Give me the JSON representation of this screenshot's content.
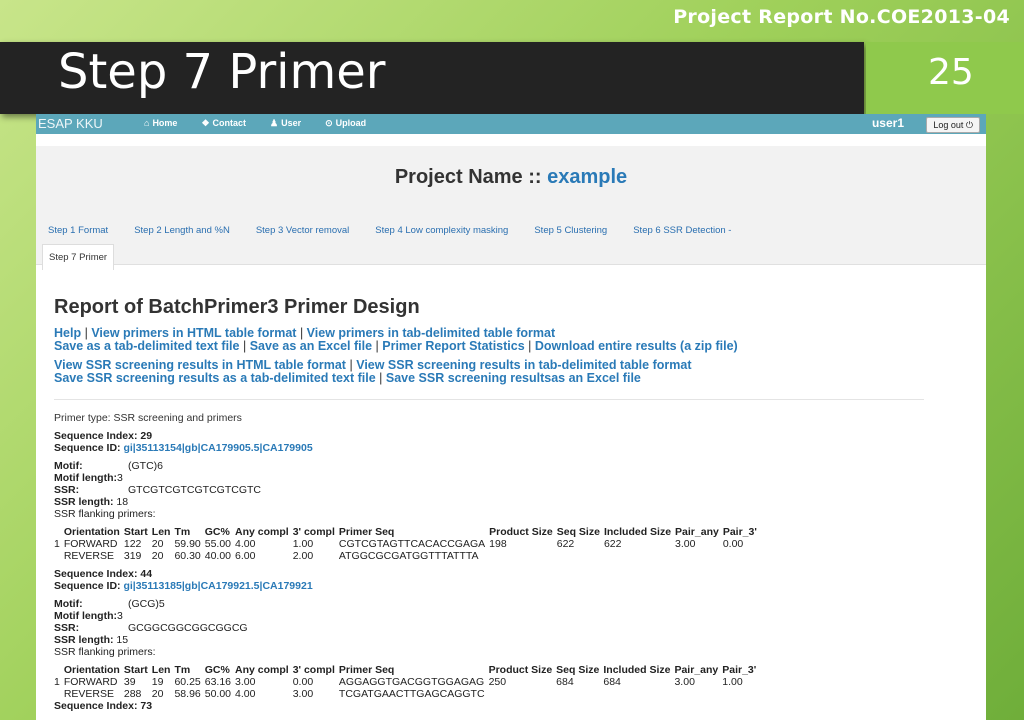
{
  "slide": {
    "report_no": "Project Report No.COE2013-04",
    "title": "Step 7 Primer",
    "page": "25"
  },
  "navbar": {
    "brand": "ESAP KKU",
    "links": [
      "Home",
      "Contact",
      "User",
      "Upload"
    ],
    "user": "user1",
    "logout": "Log out"
  },
  "project": {
    "label": "Project Name ::",
    "name": "example"
  },
  "steps": [
    "Step 1 Format",
    "Step 2 Length and %N",
    "Step 3 Vector removal",
    "Step 4 Low complexity masking",
    "Step 5 Clustering",
    "Step 6 SSR Detection -"
  ],
  "active_step": "Step 7 Primer",
  "report": {
    "title": "Report of BatchPrimer3 Primer Design",
    "links1": [
      "Help",
      "View primers in HTML table format",
      "View primers in tab-delimited table format"
    ],
    "links2": [
      "Save as a tab-delimited text file",
      "Save as an Excel file",
      "Primer Report Statistics",
      "Download entire results (a zip file)"
    ],
    "links3": [
      "View SSR screening results in HTML table format",
      "View SSR screening results in tab-delimited table format"
    ],
    "links4": [
      "Save SSR screening results as a tab-delimited text file",
      "Save SSR screening resultsas an Excel file"
    ],
    "primer_type": "Primer type: SSR screening and primers",
    "table_headers": [
      "",
      "Orientation",
      "Start",
      "Len",
      "Tm",
      "GC%",
      "Any compl",
      "3' compl",
      "Primer Seq",
      "Product Size",
      "Seq Size",
      "Included Size",
      "Pair_any",
      "Pair_3'"
    ],
    "sequences": [
      {
        "index_label": "Sequence Index: 29",
        "id_label": "Sequence ID:",
        "id": "gi|35113154|gb|CA179905.5|CA179905",
        "motif": "(GTC)6",
        "motif_length": "3",
        "ssr": "GTCGTCGTCGTCGTCGTC",
        "ssr_length": "18",
        "flanking": "SSR flanking primers:",
        "rows": [
          [
            "1",
            "FORWARD",
            "122",
            "20",
            "59.90",
            "55.00",
            "4.00",
            "1.00",
            "CGTCGTAGTTCACACCGAGA",
            "198",
            "622",
            "622",
            "3.00",
            "0.00"
          ],
          [
            "",
            "REVERSE",
            "319",
            "20",
            "60.30",
            "40.00",
            "6.00",
            "2.00",
            "ATGGCGCGATGGTTTATTTA",
            "",
            "",
            "",
            "",
            ""
          ]
        ]
      },
      {
        "index_label": "Sequence Index: 44",
        "id_label": "Sequence ID:",
        "id": "gi|35113185|gb|CA179921.5|CA179921",
        "motif": "(GCG)5",
        "motif_length": "3",
        "ssr": "GCGGCGGCGGCGGCG",
        "ssr_length": "15",
        "flanking": "SSR flanking primers:",
        "rows": [
          [
            "1",
            "FORWARD",
            "39",
            "19",
            "60.25",
            "63.16",
            "3.00",
            "0.00",
            "AGGAGGTGACGGTGGAGAG",
            "250",
            "684",
            "684",
            "3.00",
            "1.00"
          ],
          [
            "",
            "REVERSE",
            "288",
            "20",
            "58.96",
            "50.00",
            "4.00",
            "3.00",
            "TCGATGAACTTGAGCAGGTC",
            "",
            "",
            "",
            "",
            ""
          ]
        ]
      }
    ],
    "last_index": "Sequence Index: 73",
    "labels": {
      "motif": "Motif:",
      "motif_length": "Motif length:",
      "ssr": "SSR:",
      "ssr_length": "SSR length:"
    }
  }
}
